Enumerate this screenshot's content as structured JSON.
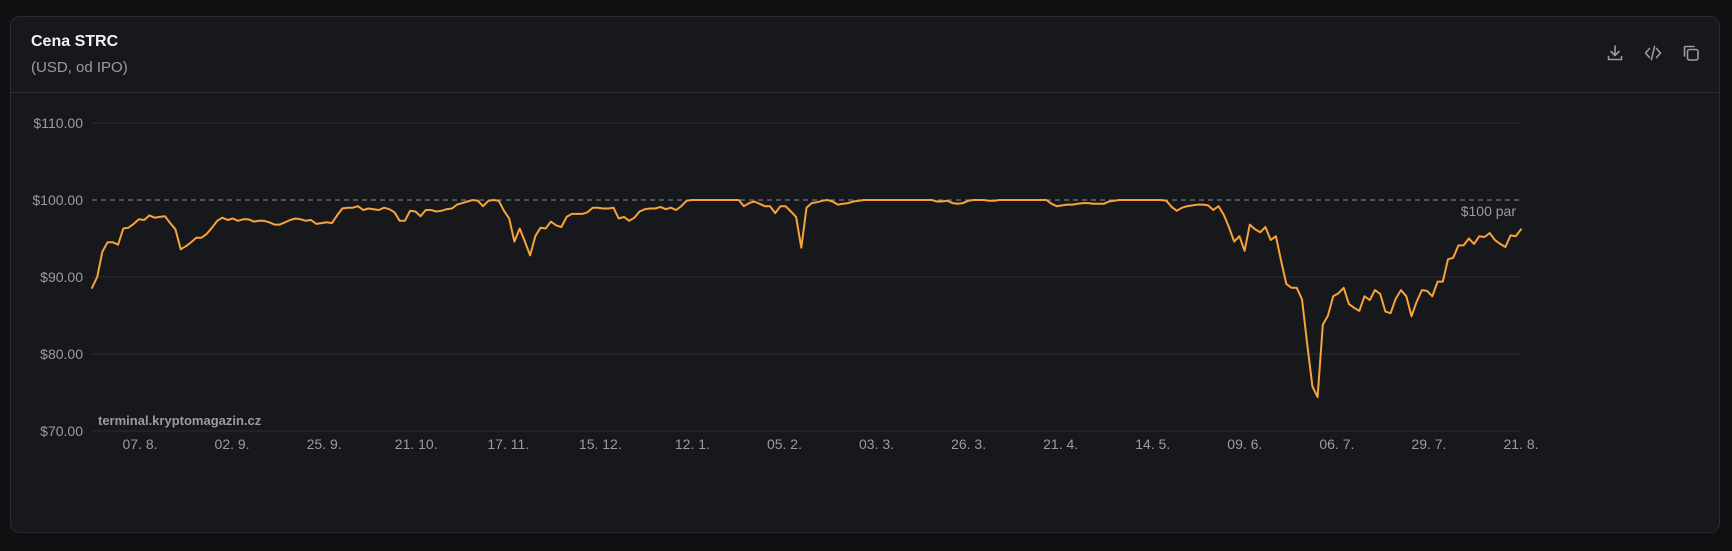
{
  "header": {
    "title": "Cena STRC",
    "subtitle": "(USD, od IPO)"
  },
  "toolbar": {
    "download_icon": "download-icon",
    "embed_icon": "code-icon",
    "copy_icon": "copy-icon"
  },
  "watermark": "terminal.kryptomagazin.cz",
  "colors": {
    "line": "#f7a23a",
    "grid": "#2a2c30",
    "reference": "#8a8c92",
    "background": "#17181b"
  },
  "chart_data": {
    "type": "line",
    "title": "Cena STRC",
    "subtitle": "(USD, od IPO)",
    "xlabel": "",
    "ylabel": "",
    "ylim": [
      70,
      110
    ],
    "yticks": [
      70,
      80,
      90,
      100,
      110
    ],
    "ytick_labels": [
      "$70.00",
      "$80.00",
      "$90.00",
      "$100.00",
      "$110.00"
    ],
    "xtick_labels": [
      "07. 8.",
      "02. 9.",
      "25. 9.",
      "21. 10.",
      "17. 11.",
      "15. 12.",
      "12. 1.",
      "05. 2.",
      "03. 3.",
      "26. 3.",
      "21. 4.",
      "14. 5.",
      "09. 6.",
      "06. 7.",
      "29. 7.",
      "21. 8."
    ],
    "grid": true,
    "legend": "none",
    "reference_line": {
      "y": 100,
      "label": "$100 par",
      "style": "dashed"
    },
    "series": [
      {
        "values": [
          88.6,
          90.0,
          93.3,
          94.5,
          94.5,
          94.2,
          96.3,
          96.4,
          96.9,
          97.5,
          97.4,
          98.0,
          97.7,
          97.8,
          97.9,
          97.0,
          96.2,
          93.6,
          94.0,
          94.5,
          95.1,
          95.1,
          95.6,
          96.4,
          97.3,
          97.7,
          97.4,
          97.6,
          97.3,
          97.5,
          97.5,
          97.2,
          97.3,
          97.3,
          97.1,
          96.8,
          96.8,
          97.1,
          97.4,
          97.6,
          97.5,
          97.3,
          97.4,
          96.9,
          97.0,
          97.1,
          97.0,
          98.0,
          98.9,
          99.0,
          99.0,
          99.2,
          98.7,
          98.9,
          98.8,
          98.7,
          99.0,
          98.8,
          98.4,
          97.3,
          97.3,
          98.6,
          98.5,
          97.9,
          98.7,
          98.7,
          98.5,
          98.6,
          98.8,
          98.9,
          99.4,
          99.6,
          99.8,
          100.0,
          99.9,
          99.2,
          99.9,
          100.0,
          99.9,
          98.6,
          97.6,
          94.6,
          96.3,
          94.6,
          92.8,
          95.3,
          96.4,
          96.3,
          97.2,
          96.7,
          96.5,
          97.8,
          98.2,
          98.2,
          98.2,
          98.4,
          99.0,
          99.0,
          98.9,
          98.9,
          99.0,
          97.6,
          97.8,
          97.3,
          97.7,
          98.5,
          98.8,
          98.9,
          98.9,
          99.1,
          98.8,
          99.0,
          98.7,
          99.2,
          99.9,
          100.0,
          100.0,
          100.0,
          100.0,
          100.0,
          100.0,
          100.0,
          100.0,
          100.0,
          100.0,
          99.2,
          99.6,
          99.8,
          99.5,
          99.2,
          99.2,
          98.3,
          99.2,
          99.2,
          98.5,
          97.8,
          93.8,
          99.0,
          99.6,
          99.7,
          99.9,
          100.0,
          99.8,
          99.4,
          99.5,
          99.6,
          99.8,
          99.9,
          100.0,
          100.0,
          100.0,
          100.0,
          100.0,
          100.0,
          100.0,
          100.0,
          100.0,
          100.0,
          100.0,
          100.0,
          100.0,
          100.0,
          99.8,
          99.8,
          99.9,
          99.6,
          99.5,
          99.6,
          99.9,
          100.0,
          100.0,
          100.0,
          99.9,
          99.9,
          100.0,
          100.0,
          100.0,
          100.0,
          100.0,
          100.0,
          100.0,
          100.0,
          100.0,
          100.0,
          99.5,
          99.2,
          99.3,
          99.4,
          99.4,
          99.5,
          99.6,
          99.6,
          99.5,
          99.5,
          99.5,
          99.8,
          99.9,
          100.0,
          100.0,
          100.0,
          100.0,
          100.0,
          100.0,
          100.0,
          100.0,
          100.0,
          99.9,
          99.1,
          98.6,
          99.0,
          99.2,
          99.3,
          99.4,
          99.4,
          99.3,
          98.7,
          99.2,
          98.1,
          96.5,
          94.6,
          95.3,
          93.4,
          96.8,
          96.2,
          95.8,
          96.5,
          94.8,
          95.3,
          92.1,
          89.1,
          88.6,
          88.6,
          87.1,
          81.3,
          75.8,
          74.4,
          83.8,
          85.0,
          87.5,
          87.9,
          88.6,
          86.5,
          86.0,
          85.6,
          87.5,
          87.0,
          88.3,
          87.8,
          85.5,
          85.3,
          87.2,
          88.3,
          87.5,
          84.9,
          86.8,
          88.3,
          88.2,
          87.5,
          89.4,
          89.4,
          92.3,
          92.5,
          94.1,
          94.1,
          95.0,
          94.3,
          95.3,
          95.2,
          95.7,
          94.8,
          94.3,
          93.9,
          95.4,
          95.3,
          96.2
        ]
      }
    ]
  }
}
